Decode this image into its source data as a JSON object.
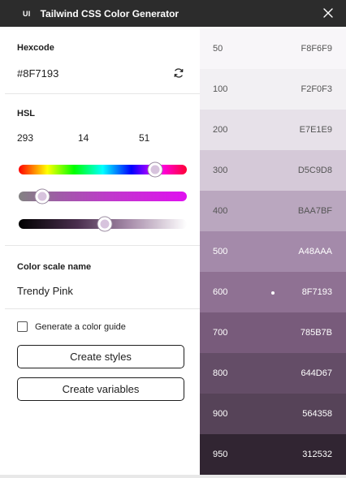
{
  "window": {
    "badge": "UI",
    "title": "Tailwind CSS Color Generator"
  },
  "hexcode": {
    "label": "Hexcode",
    "value": "#8F7193"
  },
  "hsl": {
    "label": "HSL",
    "h": "293",
    "s": "14",
    "l": "51",
    "hue_fraction": 0.81,
    "saturation_fraction": 0.14,
    "lightness_fraction": 0.51
  },
  "color_scale_name": {
    "label": "Color scale name",
    "value": "Trendy Pink"
  },
  "guide_checkbox": {
    "label": "Generate a color guide",
    "checked": false
  },
  "buttons": {
    "create_styles": "Create styles",
    "create_variables": "Create variables"
  },
  "scale": [
    {
      "step": "50",
      "hex": "F8F6F9",
      "color": "#F8F6F9",
      "text": "#555555"
    },
    {
      "step": "100",
      "hex": "F2F0F3",
      "color": "#F2F0F3",
      "text": "#555555"
    },
    {
      "step": "200",
      "hex": "E7E1E9",
      "color": "#E7E1E9",
      "text": "#555555"
    },
    {
      "step": "300",
      "hex": "D5C9D8",
      "color": "#D5C9D8",
      "text": "#555555"
    },
    {
      "step": "400",
      "hex": "BAA7BF",
      "color": "#BAA7BF",
      "text": "#555555"
    },
    {
      "step": "500",
      "hex": "A48AAA",
      "color": "#A48AAA",
      "text": "#ffffff"
    },
    {
      "step": "600",
      "hex": "8F7193",
      "color": "#8F7193",
      "text": "#ffffff",
      "selected": true
    },
    {
      "step": "700",
      "hex": "785B7B",
      "color": "#785B7B",
      "text": "#ffffff"
    },
    {
      "step": "800",
      "hex": "644D67",
      "color": "#644D67",
      "text": "#ffffff"
    },
    {
      "step": "900",
      "hex": "564358",
      "color": "#564358",
      "text": "#ffffff"
    },
    {
      "step": "950",
      "hex": "312532",
      "color": "#312532",
      "text": "#ffffff"
    }
  ]
}
